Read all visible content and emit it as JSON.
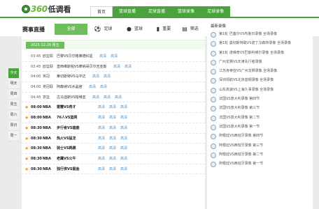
{
  "logo": {
    "num": "360",
    "cn": "低调看"
  },
  "nav": [
    "首页",
    "篮球直播",
    "足球直播",
    "篮球录像",
    "足球录像"
  ],
  "main": {
    "title": "赛事直播",
    "tabs": {
      "all": "全部",
      "football": "足球",
      "basketball": "篮球",
      "important": "重要",
      "filter": "筛选"
    },
    "date": "2025-12-26 周五",
    "matches": [
      {
        "time": "03:45",
        "league": "欧篮联",
        "teams": "巴黎VS贝尔格莱德红星",
        "links": [
          "高清",
          "高清"
        ],
        "highlight": false
      },
      {
        "time": "03:45",
        "league": "欧篮联",
        "teams": "皇西维斯帕VS摩纳哥贝尔吉亚斯",
        "links": [
          "高清",
          "高清"
        ],
        "highlight": false
      },
      {
        "time": "04:00",
        "league": "英冠",
        "teams": "莱切斯特VS马平达",
        "links": [
          "高清",
          "高清"
        ],
        "highlight": false
      },
      {
        "time": "04:00",
        "league": "英冠联",
        "teams": "阿森纳VS水晶宫",
        "links": [
          "高清",
          "高清"
        ],
        "highlight": false
      },
      {
        "time": "04:45",
        "league": "意篮",
        "teams": "古马迪斯VS帕维亚",
        "links": [
          "高清",
          "高清",
          "高清"
        ],
        "highlight": false
      },
      {
        "time": "08:00",
        "league": "NBA",
        "teams": "雷霆VS奇才",
        "links": [
          "高清",
          "高清",
          "高清"
        ],
        "highlight": true
      },
      {
        "time": "08:00",
        "league": "NBA",
        "teams": "76人VS篮网",
        "links": [
          "高清",
          "高清",
          "高清"
        ],
        "highlight": true
      },
      {
        "time": "08:30",
        "league": "NBA",
        "teams": "步行者VS雄鹿",
        "links": [
          "高清",
          "高清",
          "高清"
        ],
        "highlight": true
      },
      {
        "time": "08:30",
        "league": "NBA",
        "teams": "热火VS猛龙",
        "links": [
          "高清",
          "高清",
          "高清"
        ],
        "highlight": true
      },
      {
        "time": "08:30",
        "league": "NBA",
        "teams": "骑士VS鹈鹕",
        "links": [
          "高清",
          "高清",
          "高清"
        ],
        "highlight": true
      },
      {
        "time": "08:30",
        "league": "NBA",
        "teams": "老鹰VS公牛",
        "links": [
          "高清",
          "高清",
          "高清"
        ],
        "highlight": true
      },
      {
        "time": "08:30",
        "league": "NBA",
        "teams": "独行侠VS掘金",
        "links": [
          "高清",
          "高清",
          "高清"
        ],
        "highlight": true
      }
    ]
  },
  "side_dates": [
    "今天",
    "明天",
    "周四",
    "周五",
    "周六",
    "周日",
    "周一"
  ],
  "recent": {
    "title": "最新录像",
    "items": [
      "第1轮 巴塞尔VS布鲁日录像 全场录像",
      "第1轮 曼彻斯特联VS诺丁汉森林录像 全场录像",
      "第1轮 诺维奇VS巴斯利维尔录像 全场录像",
      "广州龙狮VS天津先行者录像",
      "江苏肯帝亚VS广州龙狮录像 全场录像",
      "深圳领航VS北京首钢录像 全场录像",
      "山东高速VS上海久事录像 全场录像",
      "法国VS意大利录像 第四节",
      "法国VS意大利录像 第三节",
      "法国VS意大利录像 第二节",
      "法国VS意大利录像 第一节",
      "阿根廷VS西班牙录像 第四节",
      "阿根廷VS西班牙录像 第三节",
      "阿根廷VS西班牙录像 第二节",
      "阿根廷VS西班牙录像 第一节"
    ]
  }
}
